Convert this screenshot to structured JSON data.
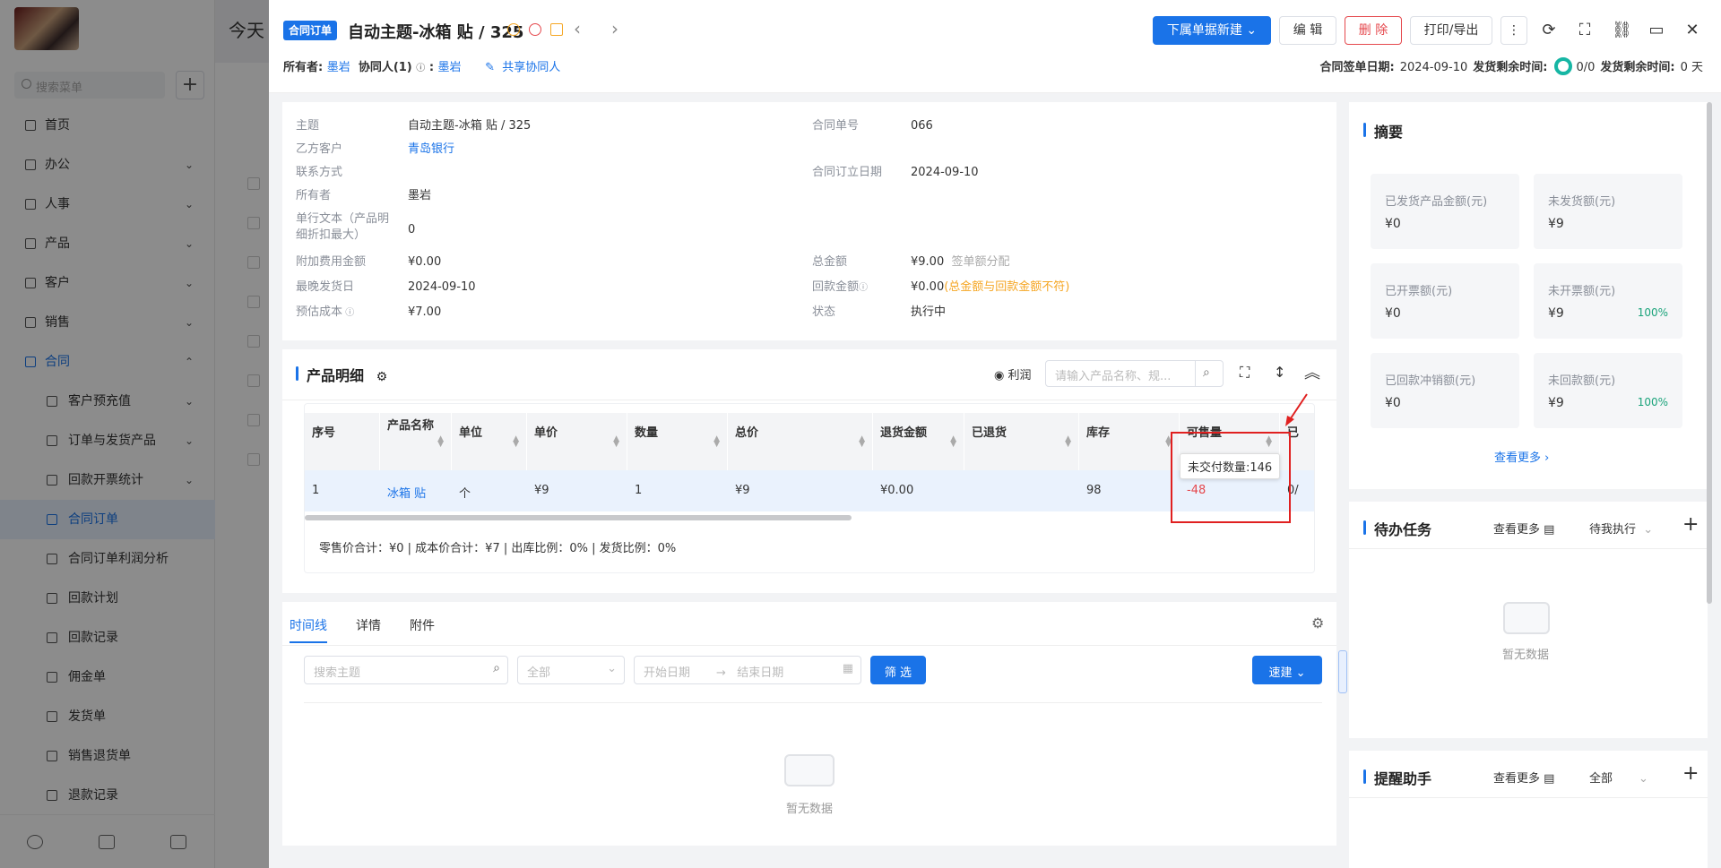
{
  "background": {
    "title": "今天",
    "search_placeholder": "搜索菜单",
    "nav": [
      {
        "label": "首页",
        "chevron": "",
        "icon": "home-icon"
      },
      {
        "label": "办公",
        "chevron": "⌄",
        "icon": "office-icon"
      },
      {
        "label": "人事",
        "chevron": "⌄",
        "icon": "people-icon"
      },
      {
        "label": "产品",
        "chevron": "⌄",
        "icon": "product-icon"
      },
      {
        "label": "客户",
        "chevron": "⌄",
        "icon": "customer-icon"
      },
      {
        "label": "销售",
        "chevron": "⌄",
        "icon": "sales-icon"
      },
      {
        "label": "合同",
        "chevron": "⌃",
        "icon": "contract-icon"
      },
      {
        "label": "客户预充值",
        "chevron": "⌄",
        "icon": "copy-icon"
      },
      {
        "label": "订单与发货产品",
        "chevron": "⌄",
        "icon": "copy-icon"
      },
      {
        "label": "回款开票统计",
        "chevron": "⌄",
        "icon": "copy-icon"
      },
      {
        "label": "合同订单",
        "chevron": "",
        "icon": "doc-icon"
      },
      {
        "label": "合同订单利润分析",
        "chevron": "",
        "icon": "doc-icon"
      },
      {
        "label": "回款计划",
        "chevron": "",
        "icon": "doc-icon"
      },
      {
        "label": "回款记录",
        "chevron": "",
        "icon": "doc-icon"
      },
      {
        "label": "佣金单",
        "chevron": "",
        "icon": "doc-icon"
      },
      {
        "label": "发货单",
        "chevron": "",
        "icon": "doc-icon"
      },
      {
        "label": "销售退货单",
        "chevron": "",
        "icon": "doc-icon"
      },
      {
        "label": "退款记录",
        "chevron": "",
        "icon": "doc-icon"
      }
    ]
  },
  "header": {
    "tag": "合同订单",
    "title": "自动主题-冰箱 贴 / 325",
    "owner_label": "所有者:",
    "owner": "墨岩",
    "collab_label": "协同人(1)",
    "collab_sep": ":",
    "collab": "墨岩",
    "share": "共享协同人",
    "btn_new": "下属单据新建",
    "btn_edit": "编 辑",
    "btn_delete": "删 除",
    "btn_print": "打印/导出",
    "sign_date_label": "合同签单日期:",
    "sign_date": "2024-09-10",
    "ship_remain_label": "发货剩余时间:",
    "ship_ratio": "0/0",
    "ship_remain_label2": "发货剩余时间:",
    "ship_remain": "0 天"
  },
  "info": {
    "subject_k": "主题",
    "subject_v": "自动主题-冰箱 贴 / 325",
    "customer_k": "乙方客户",
    "customer_v": "青岛银行",
    "contact_k": "联系方式",
    "owner_k": "所有者",
    "owner_v": "墨岩",
    "single_k": "单行文本（产品明细折扣最大）",
    "single_v": "0",
    "extra_k": "附加费用金额",
    "extra_v": "¥0.00",
    "ship_k": "最晚发货日",
    "ship_v": "2024-09-10",
    "cost_k": "预估成本",
    "cost_v": "¥7.00",
    "no_k": "合同单号",
    "no_v": "066",
    "date_k": "合同订立日期",
    "date_v": "2024-09-10",
    "total_k": "总金额",
    "total_v": "¥9.00",
    "total_hint": "签单额分配",
    "pay_k": "回款金额",
    "pay_v": "¥0.00",
    "pay_warn": "(总金额与回款金额不符)",
    "status_k": "状态",
    "status_v": "执行中"
  },
  "products": {
    "title": "产品明细",
    "profit": "利润",
    "search_placeholder": "请输入产品名称、规...",
    "columns": [
      "序号",
      "产品名称",
      "单位",
      "单价",
      "数量",
      "总价",
      "退货金额",
      "已退货",
      "库存",
      "可售量",
      "已"
    ],
    "row": [
      "1",
      "冰箱 贴",
      "个",
      "¥9",
      "1",
      "¥9",
      "¥0.00",
      "",
      "98",
      "-48",
      "0/"
    ],
    "tooltip": "未交付数量:146",
    "summary": "零售价合计：¥0 |   成本价合计：¥7 |   出库比例：0% |   发货比例：0%"
  },
  "timeline": {
    "tabs": [
      "时间线",
      "详情",
      "附件"
    ],
    "search_placeholder": "搜索主题",
    "filter_all": "全部",
    "start_date": "开始日期",
    "end_date": "结束日期",
    "filter_btn": "筛 选",
    "quick_btn": "速建",
    "empty": "暂无数据"
  },
  "summary_panel": {
    "title": "摘要",
    "items": [
      {
        "label": "已发货产品金额(元)",
        "value": "¥0",
        "pct": ""
      },
      {
        "label": "未发货额(元)",
        "value": "¥9",
        "pct": ""
      },
      {
        "label": "已开票额(元)",
        "value": "¥0",
        "pct": ""
      },
      {
        "label": "未开票额(元)",
        "value": "¥9",
        "pct": "100%"
      },
      {
        "label": "已回款冲销额(元)",
        "value": "¥0",
        "pct": ""
      },
      {
        "label": "未回款额(元)",
        "value": "¥9",
        "pct": "100%"
      }
    ],
    "more": "查看更多"
  },
  "todo": {
    "title": "待办任务",
    "more": "查看更多",
    "filter": "待我执行",
    "empty": "暂无数据"
  },
  "remind": {
    "title": "提醒助手",
    "more": "查看更多",
    "filter": "全部"
  }
}
